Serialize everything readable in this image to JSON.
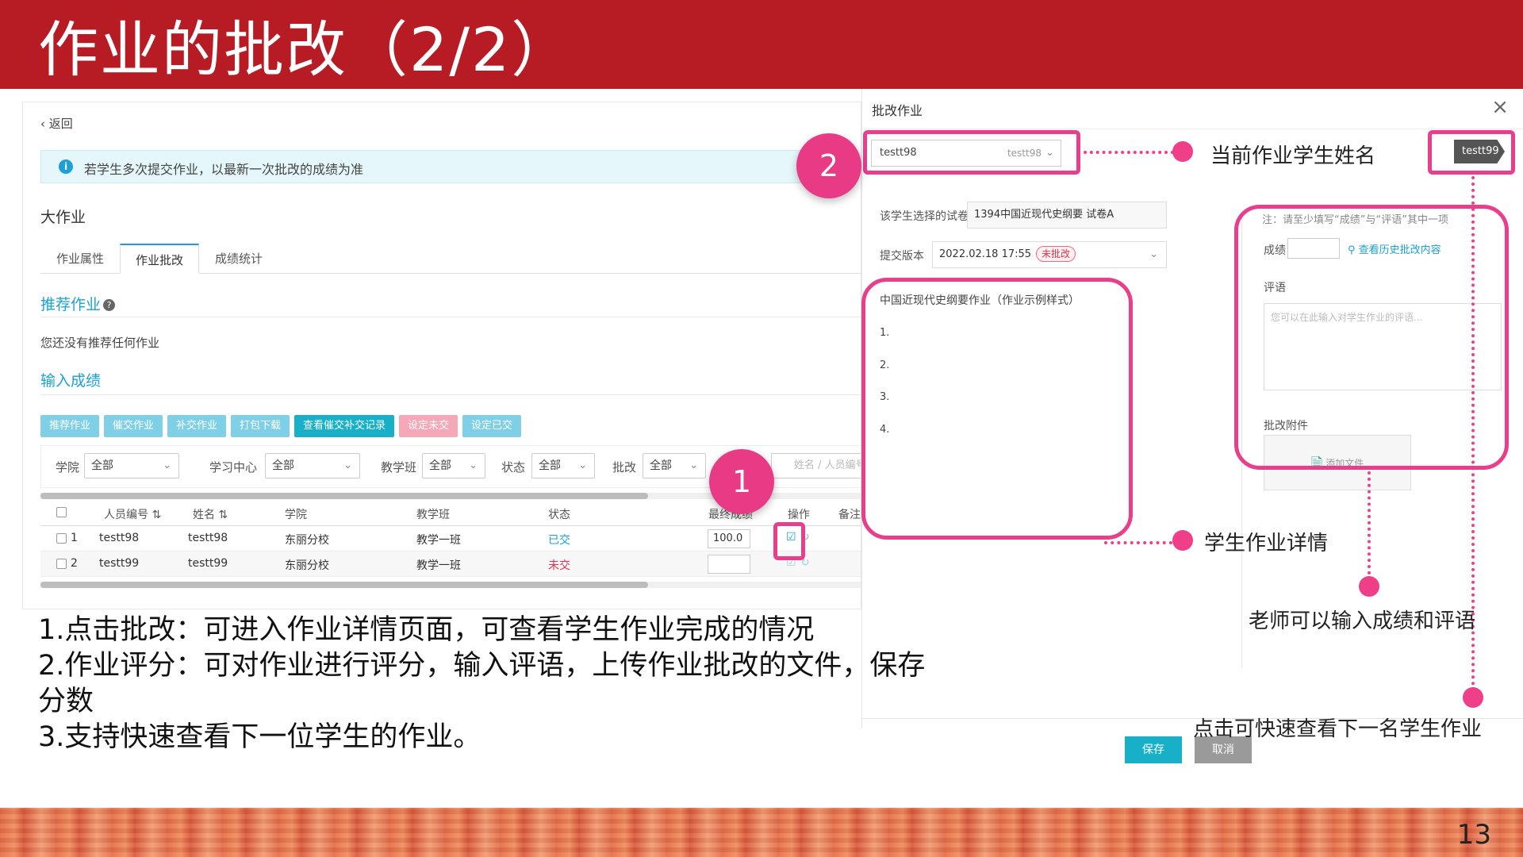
{
  "header": {
    "title": "作业的批改（2/2）"
  },
  "page_number": "13",
  "left": {
    "back": "返回",
    "notice": "若学生多次提交作业，以最新一次批改的成绩为准",
    "homework_title": "大作业",
    "tabs": [
      "作业属性",
      "作业批改",
      "成绩统计"
    ],
    "recommend_title": "推荐作业",
    "recommend_empty": "您还没有推荐任何作业",
    "input_title": "输入成绩",
    "buttons": [
      "推荐作业",
      "催交作业",
      "补交作业",
      "打包下载",
      "查看催交补交记录",
      "设定未交",
      "设定已交"
    ],
    "filters": [
      {
        "label": "学院",
        "value": "全部"
      },
      {
        "label": "学习中心",
        "value": "全部"
      },
      {
        "label": "教学班",
        "value": "全部"
      },
      {
        "label": "状态",
        "value": "全部"
      },
      {
        "label": "批改",
        "value": "全部"
      }
    ],
    "search_placeholder": "姓名 / 人员编号",
    "columns": [
      "人员编号",
      "姓名",
      "学院",
      "教学班",
      "状态",
      "最终成绩",
      "操作",
      "备注"
    ],
    "rows": [
      {
        "no": "1",
        "id": "testt98",
        "name": "testt98",
        "college": "东丽分校",
        "class": "教学一班",
        "status": "已交",
        "score": "100.0"
      },
      {
        "no": "2",
        "id": "testt99",
        "name": "testt99",
        "college": "东丽分校",
        "class": "教学一班",
        "status": "未交",
        "score": ""
      }
    ],
    "colors": {
      "submitted": "#1ba1d6",
      "not_submitted": "#e0334f"
    }
  },
  "dialog": {
    "title": "批改作业",
    "student_select": "testt98",
    "student_select_right": "testt98",
    "next_student": "testt99",
    "paper_label": "该学生选择的试卷",
    "paper_value": "1394中国近现代史纲要 试卷A",
    "version_label": "提交版本",
    "version_value": "2022.02.18 17:55",
    "version_status": "未批改",
    "paper_title": "中国近现代史纲要作业（作业示例样式）",
    "paper_items": [
      "1.",
      "2.",
      "3.",
      "4."
    ],
    "hint": "注：请至少填写“成绩”与“评语”其中一项",
    "score_label": "成绩",
    "history_link": "查看历史批改内容",
    "comment_label": "评语",
    "comment_placeholder": "您可以在此输入对学生作业的评语...",
    "attach_label": "批改附件",
    "attach_button": "添加文件",
    "save": "保存",
    "cancel": "取消"
  },
  "annotations": {
    "badge1": "1",
    "badge2": "2",
    "current_student": "当前作业学生姓名",
    "detail": "学生作业详情",
    "teacher_input": "老师可以输入成绩和评语",
    "next_student": "点击可快速查看下一名学生作业",
    "accent_color": "#e83e8c"
  },
  "notes": [
    "1.点击批改：可进入作业详情页面，可查看学生作业完成的情况",
    "2.作业评分：可对作业进行评分，输入评语，上传作业批改的文件，保存",
    "分数",
    "3.支持快速查看下一位学生的作业。"
  ]
}
